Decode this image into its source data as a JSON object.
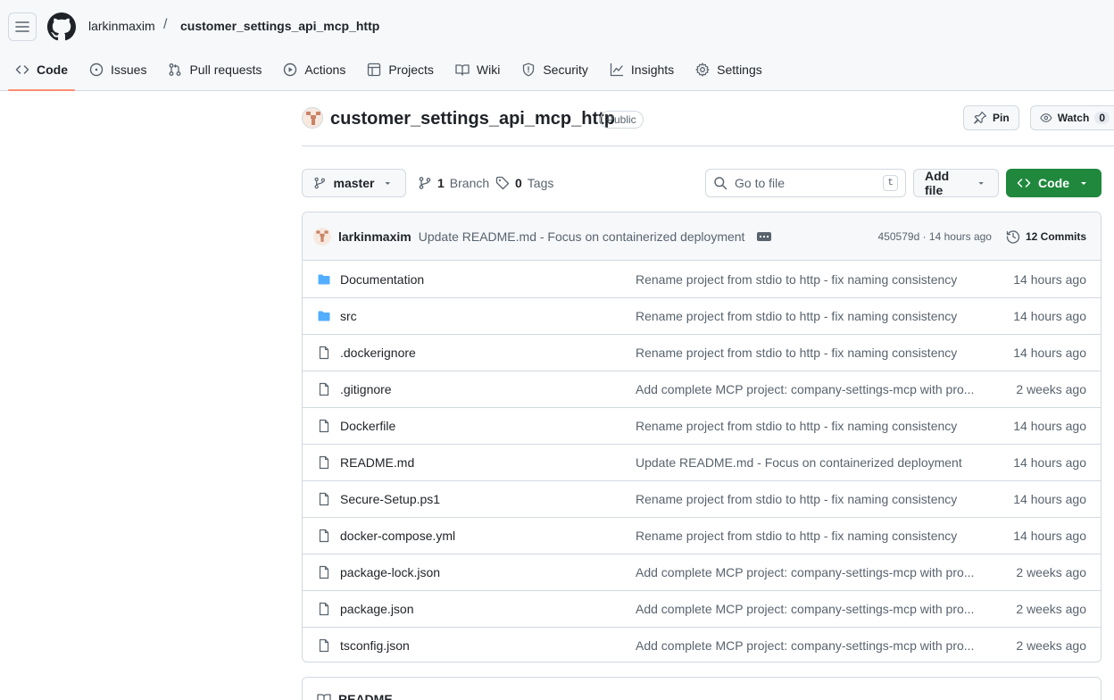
{
  "header": {
    "owner": "larkinmaxim",
    "separator": "/",
    "repo": "customer_settings_api_mcp_http"
  },
  "tabs": [
    {
      "label": "Code",
      "icon": "code-icon",
      "selected": true
    },
    {
      "label": "Issues",
      "icon": "issue-opened-icon"
    },
    {
      "label": "Pull requests",
      "icon": "git-pull-request-icon"
    },
    {
      "label": "Actions",
      "icon": "play-icon"
    },
    {
      "label": "Projects",
      "icon": "table-icon"
    },
    {
      "label": "Wiki",
      "icon": "book-icon"
    },
    {
      "label": "Security",
      "icon": "shield-icon"
    },
    {
      "label": "Insights",
      "icon": "graph-icon"
    },
    {
      "label": "Settings",
      "icon": "gear-icon"
    }
  ],
  "repo_header": {
    "title": "customer_settings_api_mcp_http",
    "visibility": "Public",
    "pin_label": "Pin",
    "watch_label": "Watch",
    "watch_count": "0"
  },
  "toolbar": {
    "branch": "master",
    "branch_count": "1",
    "branch_label": "Branch",
    "tag_count": "0",
    "tag_label": "Tags",
    "goto_placeholder": "Go to file",
    "goto_shortcut": "t",
    "add_file_label": "Add file",
    "code_label": "Code"
  },
  "latest_commit": {
    "author": "larkinmaxim",
    "message": "Update README.md - Focus on containerized deployment",
    "hash_time": "450579d · 14 hours ago",
    "commits_label": "12 Commits"
  },
  "files": [
    {
      "name": "Documentation",
      "type": "dir",
      "message": "Rename project from stdio to http - fix naming consistency",
      "age": "14 hours ago"
    },
    {
      "name": "src",
      "type": "dir",
      "message": "Rename project from stdio to http - fix naming consistency",
      "age": "14 hours ago"
    },
    {
      "name": ".dockerignore",
      "type": "file",
      "message": "Rename project from stdio to http - fix naming consistency",
      "age": "14 hours ago"
    },
    {
      "name": ".gitignore",
      "type": "file",
      "message": "Add complete MCP project: company-settings-mcp with pro...",
      "age": "2 weeks ago"
    },
    {
      "name": "Dockerfile",
      "type": "file",
      "message": "Rename project from stdio to http - fix naming consistency",
      "age": "14 hours ago"
    },
    {
      "name": "README.md",
      "type": "file",
      "message": "Update README.md - Focus on containerized deployment",
      "age": "14 hours ago"
    },
    {
      "name": "Secure-Setup.ps1",
      "type": "file",
      "message": "Rename project from stdio to http - fix naming consistency",
      "age": "14 hours ago"
    },
    {
      "name": "docker-compose.yml",
      "type": "file",
      "message": "Rename project from stdio to http - fix naming consistency",
      "age": "14 hours ago"
    },
    {
      "name": "package-lock.json",
      "type": "file",
      "message": "Add complete MCP project: company-settings-mcp with pro...",
      "age": "2 weeks ago"
    },
    {
      "name": "package.json",
      "type": "file",
      "message": "Add complete MCP project: company-settings-mcp with pro...",
      "age": "2 weeks ago"
    },
    {
      "name": "tsconfig.json",
      "type": "file",
      "message": "Add complete MCP project: company-settings-mcp with pro...",
      "age": "2 weeks ago"
    }
  ],
  "readme": {
    "label": "README"
  },
  "colors": {
    "accent_underline": "#fd8c73",
    "code_button": "#1f883d",
    "folder": "#54aeff",
    "muted_text": "#59636e"
  }
}
